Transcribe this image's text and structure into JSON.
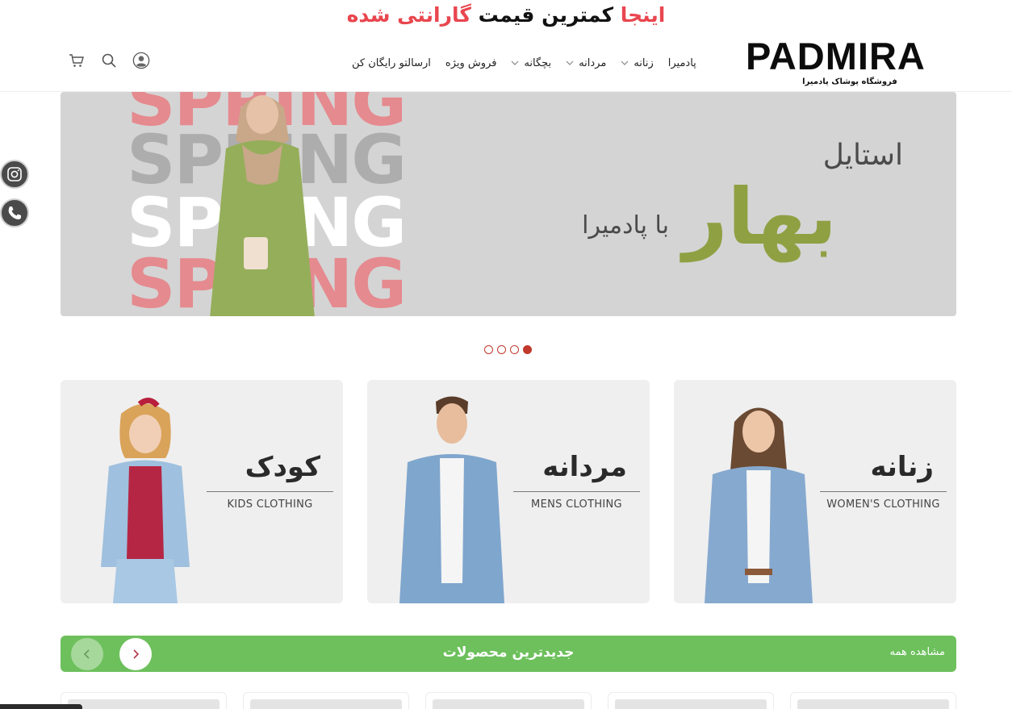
{
  "promo": {
    "part1": "اینجا",
    "part2": "کمترین قیمت",
    "part3": "گارانتی شده"
  },
  "logo": {
    "word": "PADMIRA",
    "subtitle": "فروشگاه پوشاک پادمیرا"
  },
  "nav": {
    "items": [
      {
        "label": "پادمیرا",
        "has_dropdown": false
      },
      {
        "label": "زنانه",
        "has_dropdown": true
      },
      {
        "label": "مردانه",
        "has_dropdown": true
      },
      {
        "label": "بچگانه",
        "has_dropdown": true
      },
      {
        "label": "فروش ویژه",
        "has_dropdown": false
      },
      {
        "label": "ارسالتو رایگان کن",
        "has_dropdown": false
      }
    ]
  },
  "header_icons": [
    "user-icon",
    "search-icon",
    "cart-icon"
  ],
  "hero": {
    "spring_text": "SPRING",
    "title_line1": "استایل",
    "title_line2": "بهار",
    "title_line3": "با پادمیرا",
    "accent_color": "#8fa043"
  },
  "social": [
    "instagram-icon",
    "phone-icon"
  ],
  "slider": {
    "dot_count": 4,
    "active_index": 3
  },
  "categories": [
    {
      "fa": "کودک",
      "en": "KIDS CLOTHING"
    },
    {
      "fa": "مردانه",
      "en": "MENS CLOTHING"
    },
    {
      "fa": "زنانه",
      "en": "WOMEN'S CLOTHING"
    }
  ],
  "products_bar": {
    "title": "جدیدترین محصولات",
    "view_all": "مشاهده همه",
    "color": "#6dc05c"
  },
  "colors": {
    "brand_red": "#e9464f",
    "dot_red": "#c0392b"
  }
}
